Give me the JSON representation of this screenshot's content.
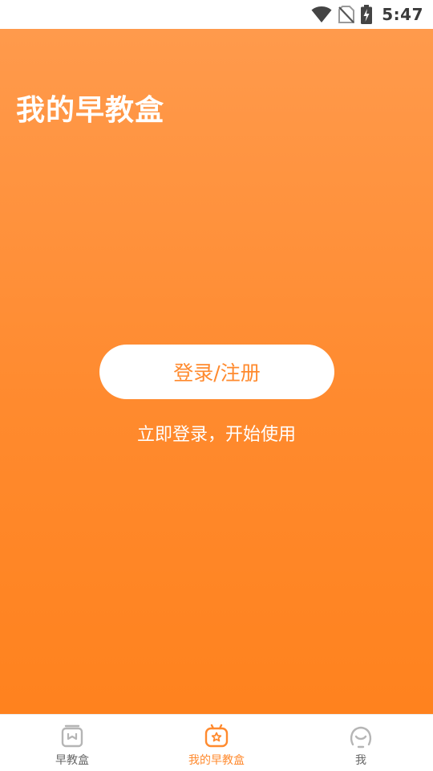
{
  "status_bar": {
    "time": "5:47",
    "icons": [
      "wifi-icon",
      "no-sim-icon",
      "battery-charging-icon"
    ]
  },
  "header": {
    "title": "我的早教盒"
  },
  "login": {
    "button_label": "登录/注册",
    "hint": "立即登录，开始使用"
  },
  "bottom_nav": {
    "items": [
      {
        "label": "早教盒",
        "icon": "box-icon",
        "active": false
      },
      {
        "label": "我的早教盒",
        "icon": "my-box-icon",
        "active": true
      },
      {
        "label": "我",
        "icon": "face-icon",
        "active": false
      }
    ]
  },
  "colors": {
    "accent": "#ff8a2e",
    "gradient_top": "#ff9a4c",
    "gradient_bottom": "#ff821e",
    "inactive_icon": "#b5b5b5"
  }
}
